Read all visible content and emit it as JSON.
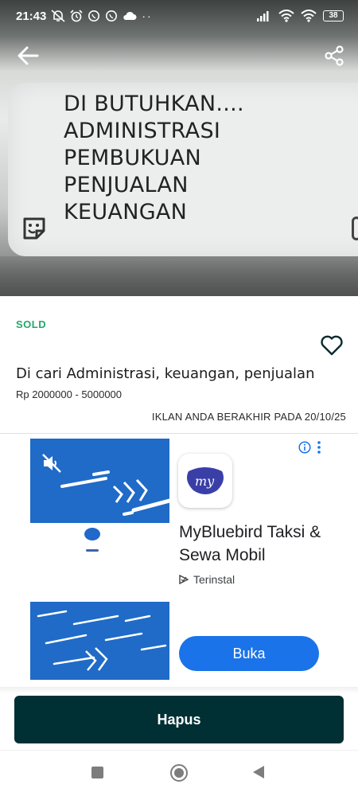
{
  "status_bar": {
    "time": "21:43",
    "battery": "38"
  },
  "hero": {
    "paper_lines": [
      "DI BUTUHKAN....",
      "ADMINISTRASI",
      "PEMBUKUAN",
      "PENJUALAN",
      "KEUANGAN"
    ]
  },
  "listing": {
    "status": "SOLD",
    "title": "Di cari Administrasi, keuangan, penjualan",
    "price": "Rp 2000000 - 5000000",
    "expiry": "IKLAN ANDA BERAKHIR PADA 20/10/25"
  },
  "ad": {
    "app_name": "MyBluebird Taksi & Sewa Mobil",
    "installed_label": "Terinstal",
    "open_label": "Buka",
    "app_icon_text": "my"
  },
  "actions": {
    "delete_label": "Hapus"
  },
  "colors": {
    "sold_green": "#23a86b",
    "delete_button": "#002f34",
    "ad_blue": "#1f6bc7",
    "open_button": "#1a73e8"
  },
  "icons": [
    "back-arrow-icon",
    "share-icon",
    "sticker-icon",
    "heart-icon",
    "mute-icon",
    "info-icon",
    "more-vert-icon",
    "installed-icon"
  ]
}
